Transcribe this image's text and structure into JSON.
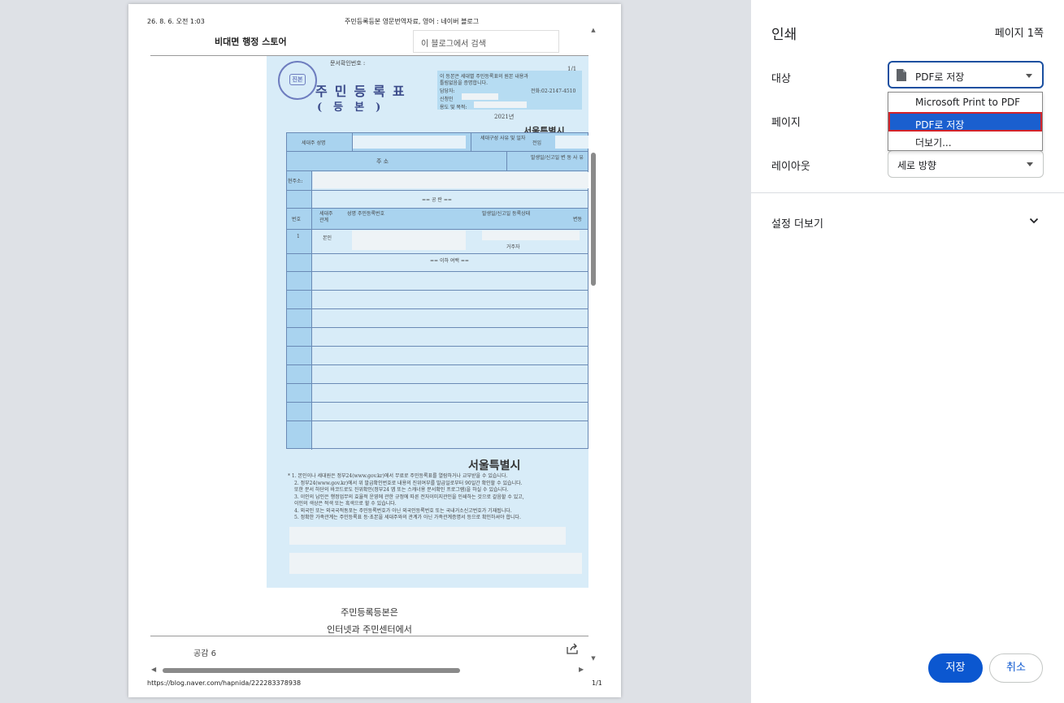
{
  "preview": {
    "header_left": "26. 8. 6. 오전 1:03",
    "header_center": "주민등록등본 영문번역자료, 영어 : 네이버 블로그",
    "footer_left": "https://blog.naver.com/hapnida/222283378938",
    "footer_right": "1/1",
    "blog_name": "비대면 행정 스토어",
    "blog_search_placeholder": "이 블로그에서 검색",
    "document": {
      "doc_number_label": "문서확인번호 :",
      "page_count": "1/1",
      "seal_text": "진본",
      "title": "주민등록표",
      "subtitle": "(등본)",
      "info_lines": [
        "이 등본은 세대별 주민등록표의 원본 내용과",
        "틀림없음을 증명합니다.",
        "담당자:",
        "전화:02-2147-4510",
        "신청인",
        "용도 및 목적:"
      ],
      "year": "2021년",
      "city_top": "서울특별시",
      "city_bottom": "서울특별시",
      "head_label": "세대주 성명",
      "reason_label": "세대구성 사유 및 일자",
      "reason_value": "전입",
      "address_header": "주                    소",
      "occurrence_header": "발생일/신고일 변 동 사 유",
      "current_address": "현주소:",
      "blank_line": "== 공    란 ==",
      "col_no": "번호",
      "col_relation": "세대주 관계",
      "col_name": "성명 주민등록번호",
      "col_occurrence": "발생일/신고일 등록상태",
      "col_change": "변동",
      "row_no": "1",
      "row_relation": "본인",
      "row_status": "거주자",
      "end_line": "== 이하 여백 ==",
      "notes": [
        "* 1. 본인이나 세대원은 정부24(www.gov.kr)에서 무료로 주민등록표를 열람하거나 교부받을 수 있습니다.",
        "2. 정부24(www.gov.kr)에서 위 발급확인번호로 내용의 진위여부를 발급일로부터 90일간 확인할 수 있습니다.",
        "또한 문서 하단의 바코드로도 진위확인(정부24 앱 또는 스캐너용 문서확인 프로그램)을 하실 수 있습니다.",
        "3. 이인의 납인은 행정업무의 효율적 운영에 관한 규정에 따른 전자이미지관인을 인쇄하는 것으로 갈음할 수 있고,",
        "이인의 색상은 적색 또는 흑색으로 할 수 있습니다.",
        "4. 외국인 또는 외국국적동포는 주민등록번호가 아닌 외국인등록번호 또는 국내거소신고번호가 기재됩니다.",
        "5. 정확한 가족관계는 주민등록표 등·초본을 세대주와의 관계가 아닌 가족관계증명서 등으로 확인하셔야 합니다."
      ]
    },
    "caption_1": "주민등록등본은",
    "caption_2": "인터넷과 주민센터에서",
    "like_label": "공감 6"
  },
  "panel": {
    "title": "인쇄",
    "page_count": "페이지 1쪽",
    "destination_label": "대상",
    "destination_value": "PDF로 저장",
    "destination_options": [
      "Microsoft Print to PDF",
      "PDF로 저장",
      "더보기..."
    ],
    "pages_label": "페이지",
    "layout_label": "레이아웃",
    "layout_value": "세로 방향",
    "more_settings": "설정 더보기",
    "save_button": "저장",
    "cancel_button": "취소"
  },
  "colors": {
    "primary_button": "#0b57d0",
    "selected_option": "#1a5fcf",
    "highlight_border": "#d2232a",
    "document_background": "#d8ecf8"
  }
}
